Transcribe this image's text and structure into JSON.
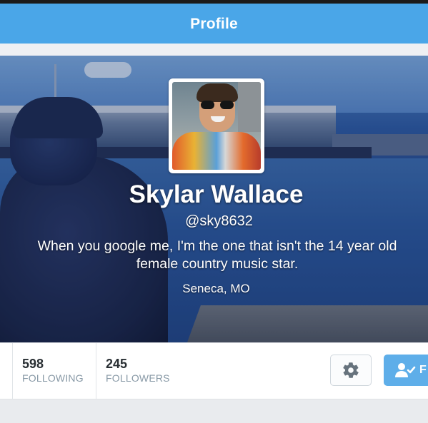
{
  "nav": {
    "title": "Profile"
  },
  "profile": {
    "name": "Skylar Wallace",
    "handle": "@sky8632",
    "bio_line1": "When you google me, I'm the one that isn't the 14 year old",
    "bio_line2": "female country music star.",
    "location": "Seneca, MO"
  },
  "stats": {
    "following": {
      "count": "598",
      "label": "FOLLOWING"
    },
    "followers": {
      "count": "245",
      "label": "FOLLOWERS"
    }
  },
  "actions": {
    "settings_icon": "gear-icon",
    "follow_icon": "add-user-icon",
    "follow_label": "F"
  },
  "colors": {
    "nav_blue": "#4aa6e8",
    "follow_blue": "#5eaee9",
    "muted_text": "#8899a6"
  }
}
